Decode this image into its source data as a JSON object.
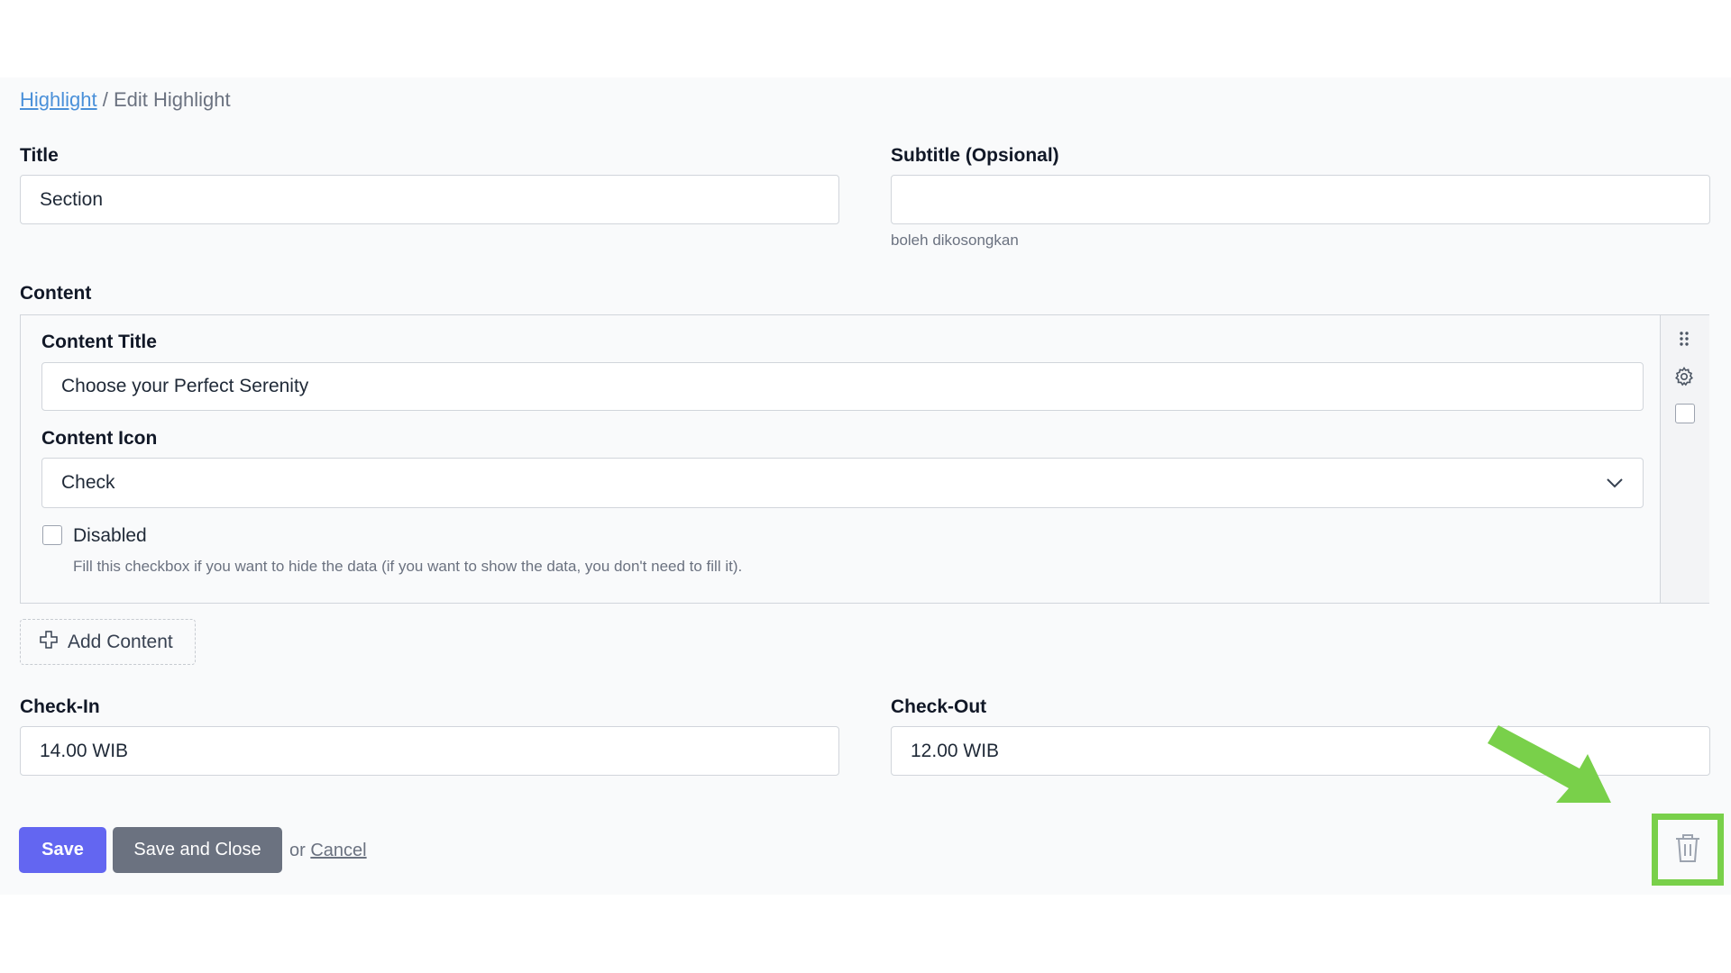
{
  "breadcrumb": {
    "link": "Highlight",
    "separator": "/",
    "current": "Edit Highlight"
  },
  "form": {
    "title": {
      "label": "Title",
      "value": "Section"
    },
    "subtitle": {
      "label": "Subtitle (Opsional)",
      "value": "",
      "hint": "boleh dikosongkan"
    },
    "content": {
      "label": "Content",
      "content_title": {
        "label": "Content Title",
        "value": "Choose your Perfect Serenity"
      },
      "content_icon": {
        "label": "Content Icon",
        "value": "Check"
      },
      "disabled": {
        "label": "Disabled",
        "checked": false,
        "hint": "Fill this checkbox if you want to hide the data (if you want to show the data, you don't need to fill it)."
      },
      "add_button": "Add Content",
      "side_icons": [
        "drag-handle-icon",
        "gear-icon",
        "select-checkbox"
      ]
    },
    "check_in": {
      "label": "Check-In",
      "value": "14.00 WIB"
    },
    "check_out": {
      "label": "Check-Out",
      "value": "12.00 WIB"
    }
  },
  "actions": {
    "save": "Save",
    "save_close": "Save and Close",
    "or": "or",
    "cancel": "Cancel"
  },
  "annotation": {
    "highlight_color": "#79d04a",
    "target": "trash-icon"
  },
  "colors": {
    "primary": "#6366f1",
    "secondary": "#6b7280",
    "link": "#4a90d9"
  }
}
